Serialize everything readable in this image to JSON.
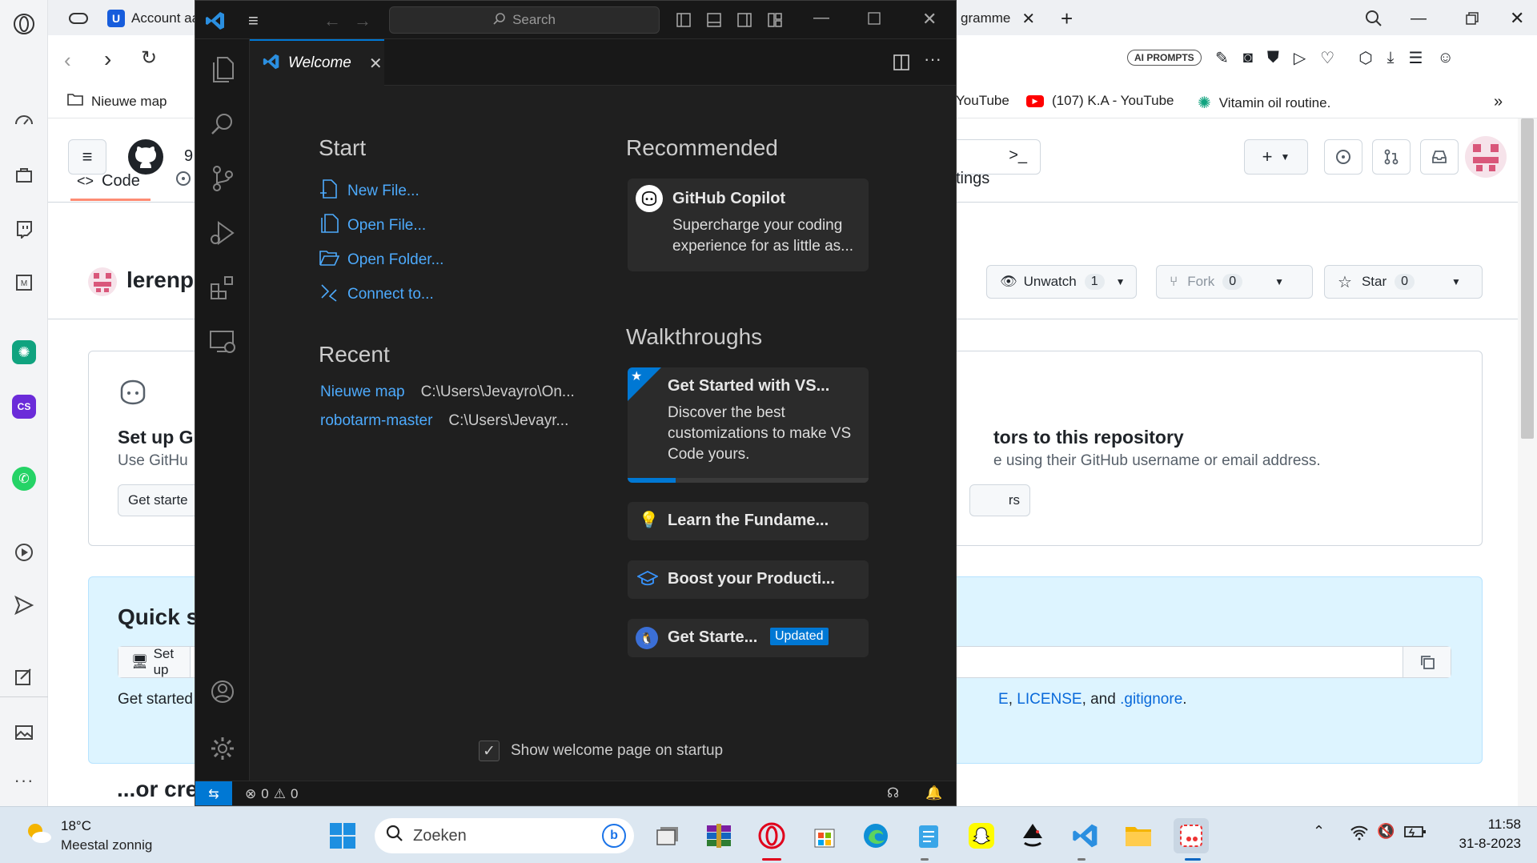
{
  "browser": {
    "tabs": [
      {
        "label": "Account aa"
      },
      {
        "label": "gramme"
      }
    ],
    "bookmarks": [
      {
        "label": "Nieuwe map"
      },
      {
        "label": "YouTube"
      },
      {
        "label": "(107) K.A - YouTube"
      },
      {
        "label": "Vitamin oil routine."
      }
    ],
    "toolbar": {
      "ai_prompts": "AI PROMPTS"
    },
    "colors": {
      "youtube_red": "#ff0000",
      "chatgpt_green": "#10a37f"
    }
  },
  "github": {
    "header_num": "9",
    "tabs": {
      "code": "Code",
      "settings": "tings"
    },
    "repo_name": "lerenp",
    "unwatch": {
      "label": "Unwatch",
      "count": "1"
    },
    "fork": {
      "label": "Fork",
      "count": "0"
    },
    "star": {
      "label": "Star",
      "count": "0"
    },
    "setup_card": {
      "title": "Set up G",
      "desc": "Use GitHu",
      "button": "Get starte",
      "right_title": "tors to this repository",
      "right_desc": "e using their GitHub username or email address.",
      "right_button": "rs"
    },
    "quick_setup": {
      "title": "Quick s",
      "setup_btn": "Set up",
      "get_started": "Get started",
      "files_tail": "E, LICENSE, and .gitignore.",
      "link_license": "LICENSE",
      "link_gitignore": ".gitignore",
      "and_text": ", and",
      "e_link": "E"
    },
    "or_create": "...or cre"
  },
  "vscode": {
    "search_placeholder": "Search",
    "tab_label": "Welcome",
    "start": {
      "heading": "Start",
      "items": [
        "New File...",
        "Open File...",
        "Open Folder...",
        "Connect to..."
      ]
    },
    "recent": {
      "heading": "Recent",
      "items": [
        {
          "name": "Nieuwe map",
          "path": "C:\\Users\\Jevayro\\On..."
        },
        {
          "name": "robotarm-master",
          "path": "C:\\Users\\Jevayr..."
        }
      ]
    },
    "recommended": {
      "heading": "Recommended",
      "card_title": "GitHub Copilot",
      "card_desc_1": "Supercharge your coding",
      "card_desc_2": "experience for as little as..."
    },
    "walkthroughs": {
      "heading": "Walkthroughs",
      "featured_title": "Get Started with VS...",
      "featured_desc_1": "Discover the best",
      "featured_desc_2": "customizations to make VS",
      "featured_desc_3": "Code yours.",
      "featured_progress": 0.2,
      "items": [
        {
          "label": "Learn the Fundame..."
        },
        {
          "label": "Boost your Producti..."
        },
        {
          "label": "Get Starte...",
          "badge": "Updated"
        }
      ]
    },
    "show_on_startup": "Show welcome page on startup",
    "status": {
      "errors": "0",
      "warnings": "0"
    },
    "colors": {
      "accent": "#0078d4",
      "link": "#4daafc"
    }
  },
  "taskbar": {
    "weather_temp": "18°C",
    "weather_desc": "Meestal zonnig",
    "search_placeholder": "Zoeken",
    "time": "11:58",
    "date": "31-8-2023"
  }
}
